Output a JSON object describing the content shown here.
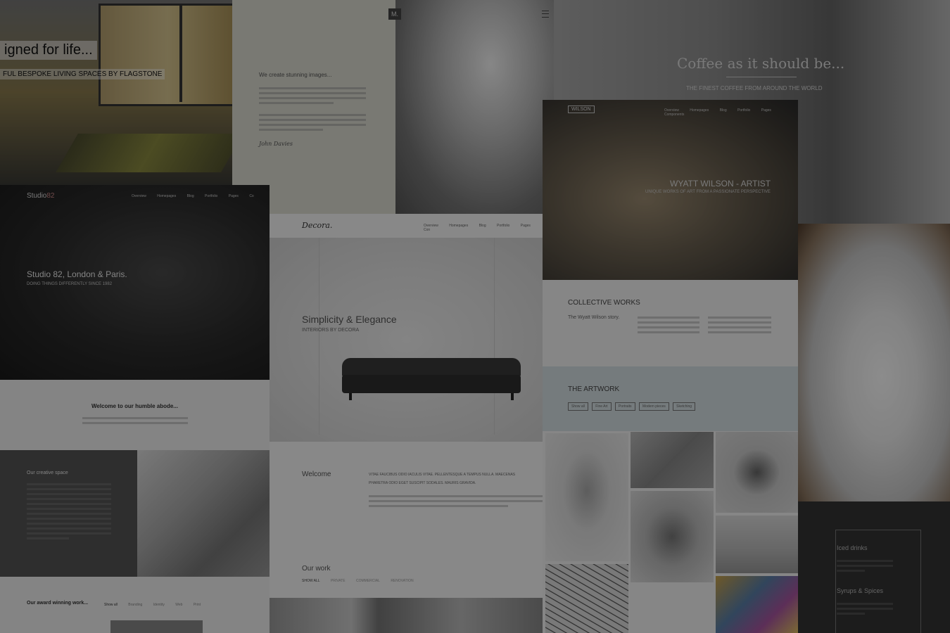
{
  "flagstone": {
    "headline": "igned for life...",
    "subline": "FUL BESPOKE LIVING SPACES BY FLAGSTONE"
  },
  "studio": {
    "logo": "Studio",
    "logo_accent": "82",
    "nav": [
      "Overview",
      "Homepages",
      "Blog",
      "Portfolio",
      "Pages",
      "Co"
    ],
    "hero_title": "Studio 82, London & Paris.",
    "hero_sub": "DOING THINGS DIFFERENTLY SINCE 1982",
    "welcome": "Welcome to our humble abode...",
    "creative_title": "Our creative space",
    "award_title": "Our award winning work...",
    "award_filters": [
      "Show all",
      "Branding",
      "Identity",
      "Web",
      "Print"
    ]
  },
  "mono": {
    "logo": "M.",
    "tagline": "We create stunning images...",
    "signature": "John Davies"
  },
  "decora": {
    "logo": "Decora.",
    "nav": [
      "Overview",
      "Homepages",
      "Blog",
      "Portfolio",
      "Pages",
      "Con"
    ],
    "hero_title": "Simplicity & Elegance",
    "hero_sub": "INTERIORS BY DECORA",
    "welcome": "Welcome",
    "welcome_text_1": "VITAE FAUCIBUS ODIO IACULIS VITAE. PELLENTESQUE A TEMPUS NULLA. MAECENAS",
    "welcome_text_2": "PHARETRA ODIO EGET SUSCIPIT SODALES. MAURIS GRAVIDA.",
    "work_title": "Our work",
    "work_filters": [
      "SHOW ALL",
      "PRIVATE",
      "COMMERCIAL",
      "RENOVATION"
    ]
  },
  "coffee": {
    "headline": "Coffee as it should be...",
    "subline": "THE FINEST COFFEE FROM AROUND THE WORLD",
    "menu_1": "Iced drinks",
    "menu_2": "Syrups & Spices"
  },
  "wilson": {
    "logo": "WILSON",
    "nav": [
      "Overview",
      "Homepages",
      "Blog",
      "Portfolio",
      "Pages",
      "Components"
    ],
    "hero_title": "WYATT WILSON - ARTIST",
    "hero_sub": "UNIQUE WORKS OF ART FROM A PASSIONATE PERSPECTIVE",
    "collective_title": "COLLECTIVE WORKS",
    "story": "The Wyatt Wilson story.",
    "artwork_title": "THE ARTWORK",
    "artwork_filters": [
      "Show all",
      "Fine Art",
      "Portraits",
      "Modern pieces",
      "Sketching"
    ]
  }
}
